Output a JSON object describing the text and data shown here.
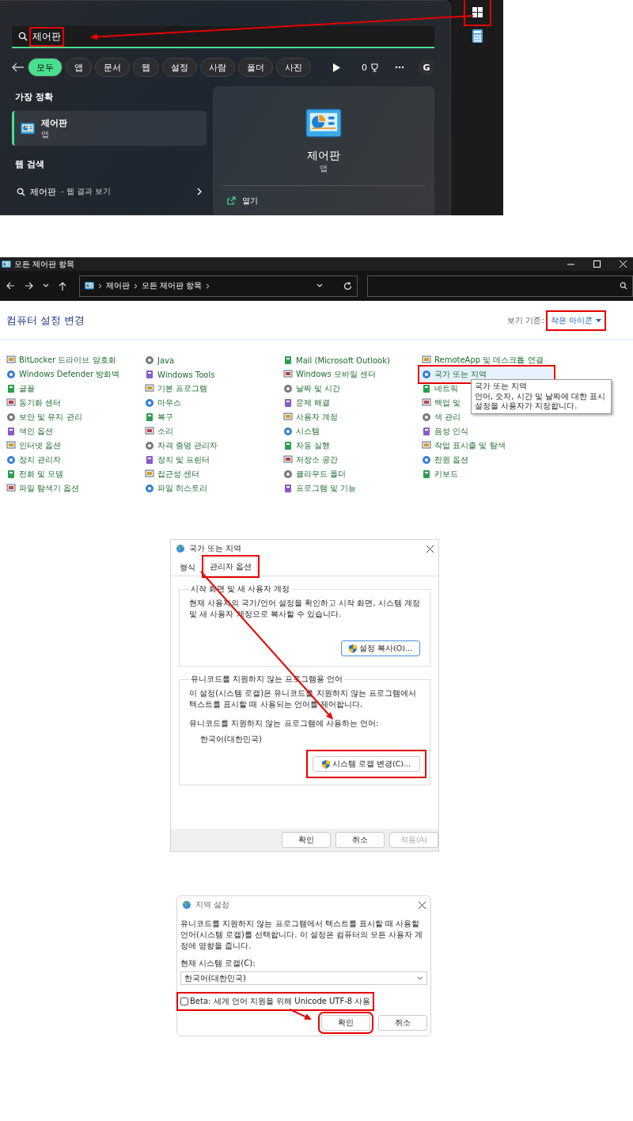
{
  "search_panel": {
    "query": "제어판",
    "filters": [
      {
        "label": "모두",
        "selected": true
      },
      {
        "label": "앱",
        "selected": false
      },
      {
        "label": "문서",
        "selected": false
      },
      {
        "label": "웹",
        "selected": false
      },
      {
        "label": "설정",
        "selected": false
      },
      {
        "label": "사람",
        "selected": false
      },
      {
        "label": "폴더",
        "selected": false
      },
      {
        "label": "사진",
        "selected": false
      }
    ],
    "points": "0",
    "avatar": "G",
    "best_match_heading": "가장 정확",
    "best_match": {
      "title": "제어판",
      "subtitle": "앱"
    },
    "web_heading": "웹 검색",
    "web_result": {
      "query": "제어판",
      "suffix": "- 웹 결과 보기"
    },
    "preview": {
      "title": "제어판",
      "subtitle": "앱",
      "actions": [
        "열기"
      ]
    }
  },
  "control_panel": {
    "title": "모든 제어판 항목",
    "breadcrumb": [
      "제어판",
      "모든 제어판 항목"
    ],
    "heading": "컴퓨터 설정 변경",
    "view_label": "보기 기준:",
    "view_value": "작은 아이콘",
    "columns": [
      [
        {
          "label": "BitLocker 드라이브 암호화",
          "selected": false
        },
        {
          "label": "Windows Defender 방화벽",
          "selected": false
        },
        {
          "label": "글꼴",
          "selected": false
        },
        {
          "label": "동기화 센터",
          "selected": false
        },
        {
          "label": "보안 및 유지 관리",
          "selected": false
        },
        {
          "label": "색인 옵션",
          "selected": false
        },
        {
          "label": "인터넷 옵션",
          "selected": false
        },
        {
          "label": "장치 관리자",
          "selected": false
        },
        {
          "label": "전화 및 모뎀",
          "selected": false
        },
        {
          "label": "파일 탐색기 옵션",
          "selected": false
        }
      ],
      [
        {
          "label": "Java",
          "selected": false
        },
        {
          "label": "Windows Tools",
          "selected": false
        },
        {
          "label": "기본 프로그램",
          "selected": false
        },
        {
          "label": "마우스",
          "selected": false
        },
        {
          "label": "복구",
          "selected": false
        },
        {
          "label": "소리",
          "selected": false
        },
        {
          "label": "자격 증명 관리자",
          "selected": false
        },
        {
          "label": "장치 및 프린터",
          "selected": false
        },
        {
          "label": "접근성 센터",
          "selected": false
        },
        {
          "label": "파일 히스토리",
          "selected": false
        }
      ],
      [
        {
          "label": "Mail (Microsoft Outlook)",
          "selected": false
        },
        {
          "label": "Windows 모바일 센터",
          "selected": false
        },
        {
          "label": "날짜 및 시간",
          "selected": false
        },
        {
          "label": "문제 해결",
          "selected": false
        },
        {
          "label": "사용자 계정",
          "selected": false
        },
        {
          "label": "시스템",
          "selected": false
        },
        {
          "label": "자동 실행",
          "selected": false
        },
        {
          "label": "저장소 공간",
          "selected": false
        },
        {
          "label": "클라우드 폴더",
          "selected": false
        },
        {
          "label": "프로그램 및 기능",
          "selected": false
        }
      ],
      [
        {
          "label": "RemoteApp 및 데스크톱 연결",
          "selected": false
        },
        {
          "label": "국가 또는 지역",
          "selected": true
        },
        {
          "label": "네트워",
          "selected": false
        },
        {
          "label": "백업 및",
          "selected": false
        },
        {
          "label": "색 관리",
          "selected": false
        },
        {
          "label": "음성 인식",
          "selected": false
        },
        {
          "label": "작업 표시줄 및 탐색",
          "selected": false
        },
        {
          "label": "전원 옵션",
          "selected": false
        },
        {
          "label": "키보드",
          "selected": false
        }
      ]
    ],
    "tooltip": {
      "title": "국가 또는 지역",
      "text": "언어, 숫자, 시간 및 날짜에 대한 표시 설정을 사용자가 지정합니다."
    }
  },
  "region_dialog": {
    "title": "국가 또는 지역",
    "tabs": [
      {
        "label": "형식",
        "selected": false
      },
      {
        "label": "관리자 옵션",
        "selected": true
      }
    ],
    "welcome_group": {
      "title": "시작 화면 및 새 사용자 계정",
      "text": "현재 사용자의 국가/언어 설정을 확인하고 시작 화면, 시스템 계정 및 새 사용자 계정으로 복사할 수 있습니다.",
      "button": "설정 복사(O)..."
    },
    "unicode_group": {
      "title": "유니코드를 지원하지 않는 프로그램용 언어",
      "text": "이 설정(시스템 로캘)은 유니코드를 지원하지 않는 프로그램에서 텍스트를 표시할 때 사용되는 언어를 제어합니다.",
      "label": "유니코드를 지원하지 않는 프로그램에 사용하는 언어:",
      "value": "한국어(대한민국)",
      "button": "시스템 로캘 변경(C)..."
    },
    "buttons": [
      {
        "label": "확인",
        "disabled": false
      },
      {
        "label": "취소",
        "disabled": false
      },
      {
        "label": "적용(A)",
        "disabled": true
      }
    ]
  },
  "locale_dialog": {
    "title": "지역 설정",
    "text": "유니코드를 지원하지 않는 프로그램에서 텍스트를 표시할 때 사용할 언어(시스템 로캘)를 선택합니다. 이 설정은 컴퓨터의 모든 사용자 계정에 영향을 줍니다.",
    "label": "현재 시스템 로캘(C):",
    "value": "한국어(대한민국)",
    "utf8_beta": {
      "label": "Beta: 세계 언어 지원을 위해 Unicode UTF-8 사용",
      "checked": false
    },
    "buttons": [
      "확인",
      "취소"
    ]
  }
}
